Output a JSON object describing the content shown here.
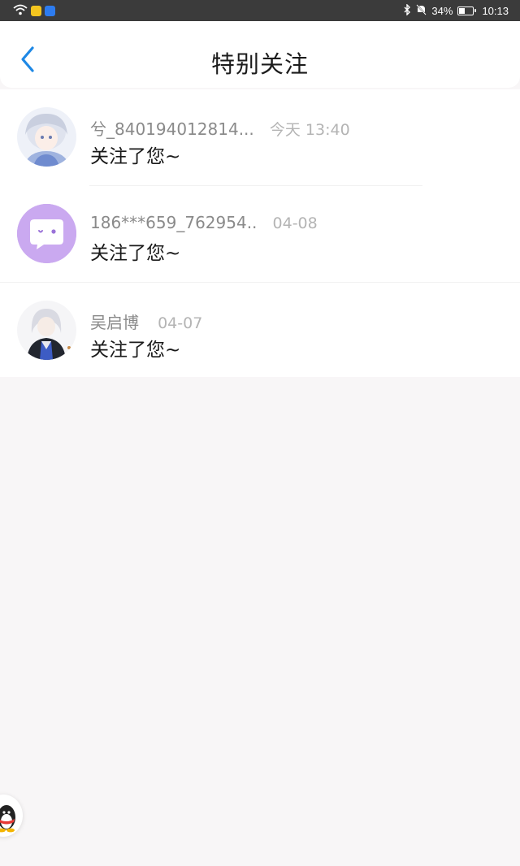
{
  "status_bar": {
    "battery_text": "34%",
    "battery_level": 0.34,
    "time": "10:13",
    "icons": [
      "wifi-icon",
      "app-notification-icon",
      "app-notification-icon",
      "bluetooth-icon",
      "mute-icon",
      "battery-icon"
    ]
  },
  "header": {
    "back_icon": "chevron-left-icon",
    "title": "特别关注"
  },
  "items": [
    {
      "name": "兮_840194012814...",
      "time": "今天 13:40",
      "message": "关注了您~"
    },
    {
      "name": "186***659_762954..",
      "time": "04-08",
      "message": "关注了您~"
    },
    {
      "name": "吴启博",
      "time": "04-07",
      "message": "关注了您~"
    }
  ],
  "floating_button": {
    "icon": "qq-penguin-icon"
  },
  "colors": {
    "accent": "#1e88e5",
    "status_bar_bg": "#3b3b3b",
    "page_bg": "#f8f6f7",
    "default_avatar_bg": "#c9a8ef"
  }
}
